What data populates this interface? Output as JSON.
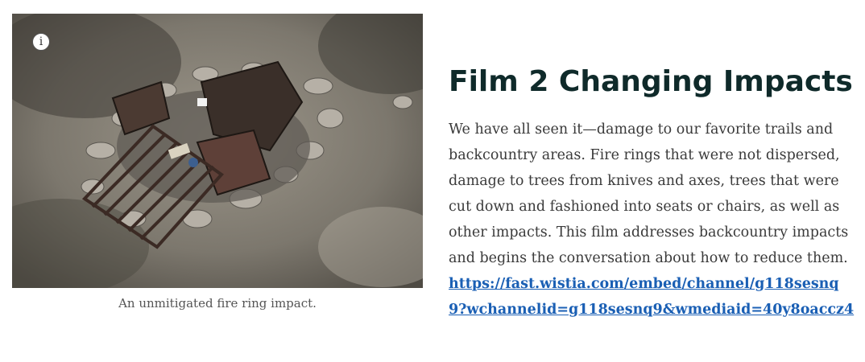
{
  "figure": {
    "image_alt": "Fire ring with metal grate and ash in a dirt campsite",
    "info_icon": "i",
    "caption": "An unmitigated fire ring impact."
  },
  "article": {
    "title": "Film 2 Changing Impacts",
    "body": "We have all seen it—damage to our favorite trails and backcountry areas. Fire rings that were not dispersed, damage to trees from knives and axes, trees that were cut down and fashioned into seats or chairs, as well as other impacts. This film addresses backcountry impacts and begins the conversation about how to reduce them.",
    "link_text": "https://fast.wistia.com/embed/channel/g118sesnq9?wchannelid=g118sesnq9&wmediaid=40y8oaccz4"
  },
  "colors": {
    "title": "#0f2a2a",
    "body": "#3a3a3a",
    "link": "#1a5fb4",
    "caption": "#555555"
  }
}
